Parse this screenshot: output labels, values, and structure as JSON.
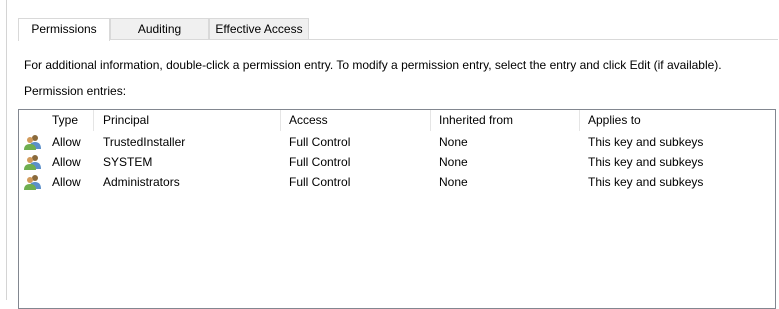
{
  "tabs": [
    {
      "label": "Permissions",
      "active": true
    },
    {
      "label": "Auditing",
      "active": false
    },
    {
      "label": "Effective Access",
      "active": false
    }
  ],
  "info_text": "For additional information, double-click a permission entry. To modify a permission entry, select the entry and click Edit (if available).",
  "entries_label": "Permission entries:",
  "table": {
    "columns": [
      "Type",
      "Principal",
      "Access",
      "Inherited from",
      "Applies to"
    ],
    "rows": [
      {
        "icon": "users-icon",
        "type": "Allow",
        "principal": "TrustedInstaller",
        "access": "Full Control",
        "inherited_from": "None",
        "applies_to": "This key and subkeys"
      },
      {
        "icon": "users-icon",
        "type": "Allow",
        "principal": "SYSTEM",
        "access": "Full Control",
        "inherited_from": "None",
        "applies_to": "This key and subkeys"
      },
      {
        "icon": "users-icon",
        "type": "Allow",
        "principal": "Administrators",
        "access": "Full Control",
        "inherited_from": "None",
        "applies_to": "This key and subkeys"
      }
    ]
  }
}
